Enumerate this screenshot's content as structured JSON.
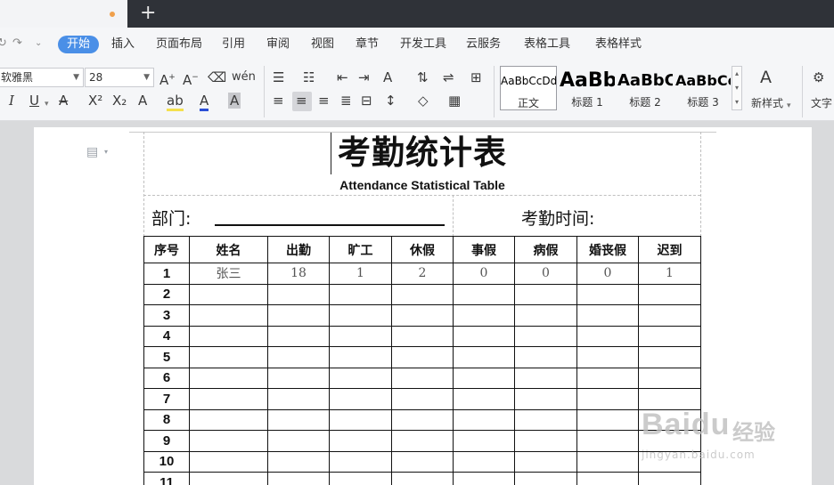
{
  "menu": {
    "items": [
      "开始",
      "插入",
      "页面布局",
      "引用",
      "审阅",
      "视图",
      "章节",
      "开发工具",
      "云服务",
      "表格工具",
      "表格样式"
    ]
  },
  "ribbon": {
    "font_name": "软雅黑",
    "font_size": "28",
    "styles": [
      {
        "sample": "AaBbCcDd",
        "label": "正文"
      },
      {
        "sample": "AaBb",
        "label": "标题 1"
      },
      {
        "sample": "AaBbC",
        "label": "标题 2"
      },
      {
        "sample": "AaBbCc",
        "label": "标题 3"
      }
    ],
    "new_style": "新样式",
    "text_tool": "文字"
  },
  "document": {
    "title": "考勤统计表",
    "subtitle": "Attendance Statistical Table",
    "dept_label": "部门:",
    "time_label": "考勤时间:",
    "table": {
      "headers": [
        "序号",
        "姓名",
        "出勤",
        "旷工",
        "休假",
        "事假",
        "病假",
        "婚丧假",
        "迟到"
      ],
      "rows": [
        [
          "1",
          "张三",
          "18",
          "1",
          "2",
          "0",
          "0",
          "0",
          "1"
        ],
        [
          "2",
          "",
          "",
          "",
          "",
          "",
          "",
          "",
          ""
        ],
        [
          "3",
          "",
          "",
          "",
          "",
          "",
          "",
          "",
          ""
        ],
        [
          "4",
          "",
          "",
          "",
          "",
          "",
          "",
          "",
          ""
        ],
        [
          "5",
          "",
          "",
          "",
          "",
          "",
          "",
          "",
          ""
        ],
        [
          "6",
          "",
          "",
          "",
          "",
          "",
          "",
          "",
          ""
        ],
        [
          "7",
          "",
          "",
          "",
          "",
          "",
          "",
          "",
          ""
        ],
        [
          "8",
          "",
          "",
          "",
          "",
          "",
          "",
          "",
          ""
        ],
        [
          "9",
          "",
          "",
          "",
          "",
          "",
          "",
          "",
          ""
        ],
        [
          "10",
          "",
          "",
          "",
          "",
          "",
          "",
          "",
          ""
        ],
        [
          "11",
          "",
          "",
          "",
          "",
          "",
          "",
          "",
          ""
        ]
      ]
    }
  },
  "watermark": {
    "brand": "Baidu",
    "brand_cn": "经验",
    "url": "jingyan.baidu.com"
  }
}
